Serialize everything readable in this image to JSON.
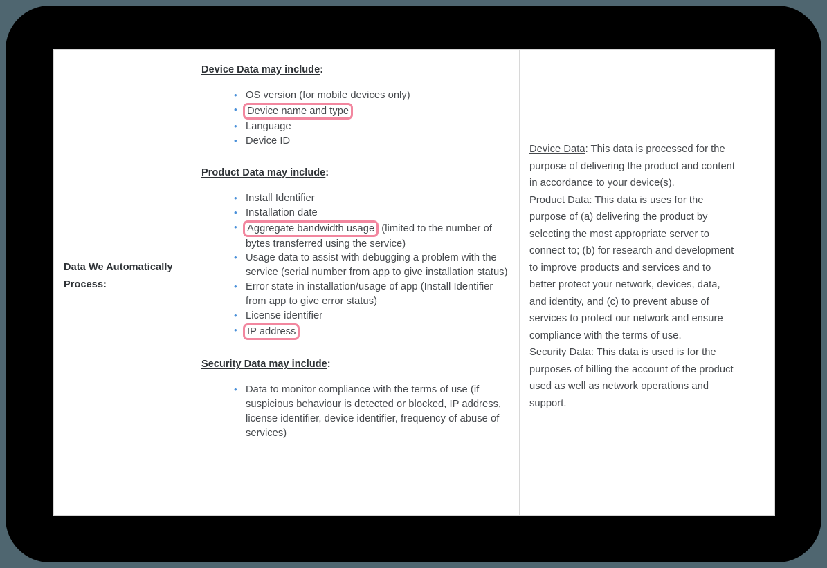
{
  "colors": {
    "page_background": "#4f6670",
    "frame": "#000000",
    "document": "#ffffff",
    "border": "#d8d8d8",
    "bullet": "#4a90d9",
    "body_text": "#46494d",
    "heading_text": "#2f3337",
    "highlight_border": "#f2879f"
  },
  "table": {
    "row_label": "Data We Automatically Process:",
    "sections": [
      {
        "heading": "Device Data may include",
        "heading_suffix": ":",
        "items": [
          {
            "text": "OS version (for mobile devices only)",
            "highlighted": false
          },
          {
            "text": "Device name and type",
            "highlighted": true
          },
          {
            "text": "Language",
            "highlighted": false
          },
          {
            "text": "Device ID",
            "highlighted": false
          }
        ]
      },
      {
        "heading": "Product Data may include",
        "heading_suffix": ":",
        "items": [
          {
            "text": "Install Identifier",
            "highlighted": false
          },
          {
            "text": "Installation date",
            "highlighted": false
          },
          {
            "text": "Aggregate bandwidth usage",
            "trailing": " (limited to the number of bytes transferred using the service)",
            "highlighted": true
          },
          {
            "text": "Usage data to assist with debugging a problem with the service (serial number from app to give installation status)",
            "highlighted": false
          },
          {
            "text": "Error state in installation/usage of app (Install Identifier from app to give error status)",
            "highlighted": false
          },
          {
            "text": "License identifier",
            "highlighted": false
          },
          {
            "text": "IP address",
            "highlighted": true
          }
        ]
      },
      {
        "heading": "Security Data may include",
        "heading_suffix": ":",
        "items": [
          {
            "text": "Data to monitor compliance with the terms of use (if suspicious behaviour is detected or blocked, IP address, license identifier, device identifier, frequency of abuse of services)",
            "highlighted": false
          }
        ]
      }
    ],
    "purposes": [
      {
        "label": "Device Data",
        "body": ": This data is processed for the purpose of delivering the product and content in accordance to your device(s)."
      },
      {
        "label": "Product Data",
        "body": ": This data is uses for the purpose of (a) delivering the product by selecting the most appropriate server to connect to; (b) for research and development to improve products and services and to better protect your network, devices, data, and identity, and (c) to prevent abuse of services to protect our network and ensure compliance with the terms of use."
      },
      {
        "label": "Security Data",
        "body": ": This data is used is for the purposes of billing the account of the product used as well as network operations and support."
      }
    ]
  }
}
